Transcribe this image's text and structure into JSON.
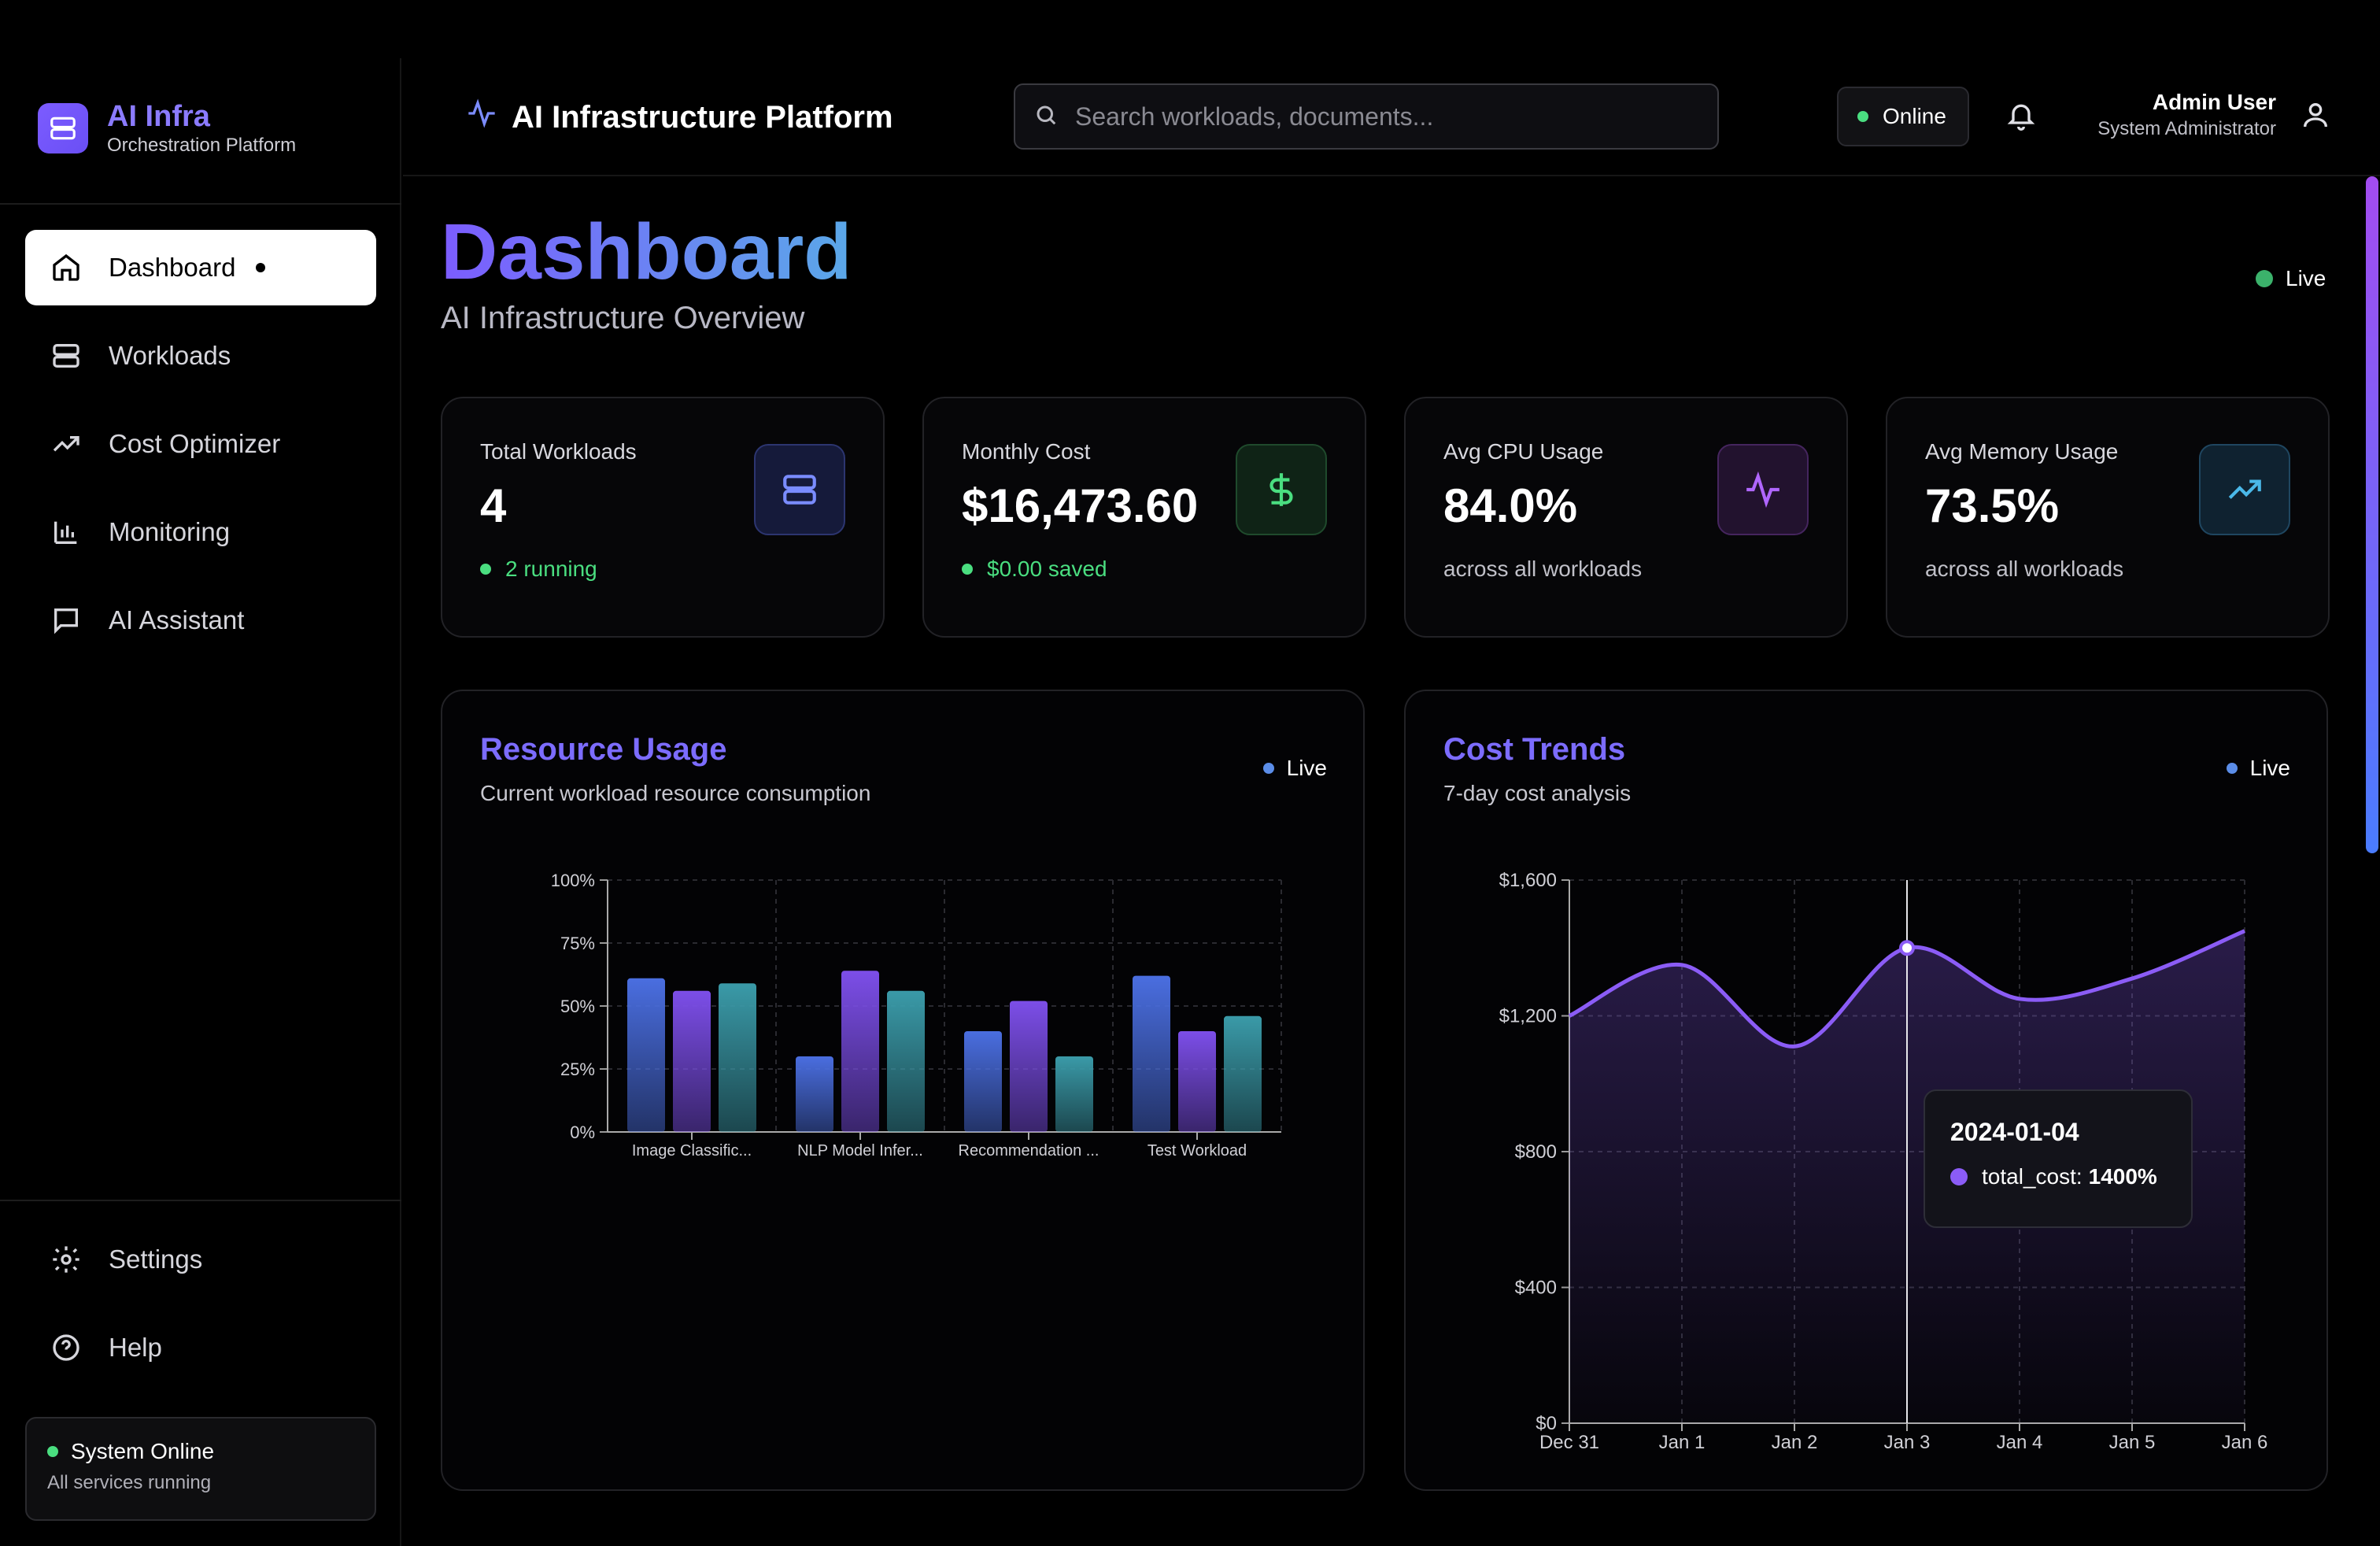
{
  "brand": {
    "title": "AI Infra",
    "subtitle": "Orchestration Platform"
  },
  "sidebar": {
    "items": [
      {
        "label": "Dashboard",
        "icon": "home-icon"
      },
      {
        "label": "Workloads",
        "icon": "server-icon"
      },
      {
        "label": "Cost Optimizer",
        "icon": "trending-up-icon"
      },
      {
        "label": "Monitoring",
        "icon": "bar-chart-icon"
      },
      {
        "label": "AI Assistant",
        "icon": "message-icon"
      }
    ],
    "bottom": [
      {
        "label": "Settings",
        "icon": "gear-icon"
      },
      {
        "label": "Help",
        "icon": "help-icon"
      }
    ],
    "status": {
      "title": "System Online",
      "subtitle": "All services running"
    }
  },
  "header": {
    "title": "AI Infrastructure Platform",
    "search_placeholder": "Search workloads, documents...",
    "online_label": "Online",
    "user_name": "Admin User",
    "user_role": "System Administrator"
  },
  "page": {
    "title": "Dashboard",
    "subtitle": "AI Infrastructure Overview",
    "live": "Live"
  },
  "stats": [
    {
      "label": "Total Workloads",
      "value": "4",
      "foot": "2 running",
      "icon": "server-icon",
      "accent": "#6b7cff"
    },
    {
      "label": "Monthly Cost",
      "value": "$16,473.60",
      "foot": "$0.00 saved",
      "icon": "dollar-icon",
      "accent": "#4ade80"
    },
    {
      "label": "Avg CPU Usage",
      "value": "84.0%",
      "foot": "across all workloads",
      "icon": "activity-icon",
      "accent": "#b066ff"
    },
    {
      "label": "Avg Memory Usage",
      "value": "73.5%",
      "foot": "across all workloads",
      "icon": "trending-up-icon",
      "accent": "#4ab8e8"
    }
  ],
  "resource_panel": {
    "title": "Resource Usage",
    "subtitle": "Current workload resource consumption",
    "live": "Live"
  },
  "cost_panel": {
    "title": "Cost Trends",
    "subtitle": "7-day cost analysis",
    "live": "Live"
  },
  "tooltip": {
    "date": "2024-01-04",
    "series": "total_cost:",
    "value": "1400%"
  },
  "chart_data": [
    {
      "type": "bar",
      "categories": [
        "Image Classific...",
        "NLP Model Infer...",
        "Recommendation ...",
        "Test Workload"
      ],
      "series": [
        {
          "values": [
            61,
            30,
            40,
            62
          ],
          "color": "#4a6ee0"
        },
        {
          "values": [
            56,
            64,
            52,
            40
          ],
          "color": "#7c4ee8"
        },
        {
          "values": [
            59,
            56,
            30,
            46
          ],
          "color": "#3a9aa8"
        }
      ],
      "yticks": [
        "0%",
        "25%",
        "50%",
        "75%",
        "100%"
      ],
      "ylim": [
        0,
        100
      ],
      "grid": true
    },
    {
      "type": "area",
      "x": [
        "Dec 31",
        "Jan 1",
        "Jan 2",
        "Jan 3",
        "Jan 4",
        "Jan 5",
        "Jan 6"
      ],
      "series": [
        {
          "values": [
            1200,
            1350,
            1110,
            1400,
            1250,
            1310,
            1450
          ],
          "color": "#8b5cf6"
        }
      ],
      "yticks": [
        "$0",
        "$400",
        "$800",
        "$1,200",
        "$1,600"
      ],
      "ylim": [
        0,
        1600
      ],
      "highlight_index": 3,
      "grid": true
    }
  ]
}
